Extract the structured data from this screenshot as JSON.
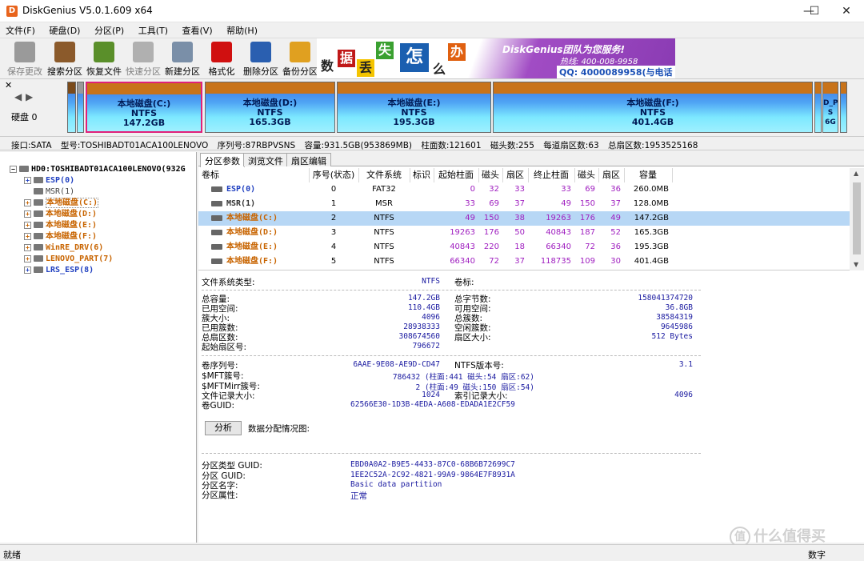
{
  "window": {
    "title": "DiskGenius V5.0.1.609 x64",
    "app_icon": "D",
    "minimize": "—",
    "maximize": "☐",
    "close": "✕"
  },
  "menu": [
    "文件(F)",
    "硬盘(D)",
    "分区(P)",
    "工具(T)",
    "查看(V)",
    "帮助(H)"
  ],
  "toolbar": [
    {
      "label": "保存更改",
      "icon": "save-icon",
      "color": "#9a9a9a",
      "enabled": false
    },
    {
      "label": "搜索分区",
      "icon": "magnifier-icon",
      "color": "#8b5a2b",
      "enabled": true
    },
    {
      "label": "恢复文件",
      "icon": "box-icon",
      "color": "#5a8f2a",
      "enabled": true
    },
    {
      "label": "快速分区",
      "icon": "disk-icon",
      "color": "#b0b0b0",
      "enabled": false
    },
    {
      "label": "新建分区",
      "icon": "drive-icon",
      "color": "#7a8fa8",
      "enabled": true
    },
    {
      "label": "格式化",
      "icon": "format-icon",
      "color": "#d01010",
      "enabled": true
    },
    {
      "label": "删除分区",
      "icon": "trash-icon",
      "color": "#2a5fb0",
      "enabled": true
    },
    {
      "label": "备份分区",
      "icon": "backup-icon",
      "color": "#e0a020",
      "enabled": true
    }
  ],
  "banner": {
    "chars": [
      {
        "c": "数",
        "bg": "#ffffff",
        "fg": "#222222"
      },
      {
        "c": "据",
        "bg": "#c01818",
        "fg": "#ffffff"
      },
      {
        "c": "丢",
        "bg": "#f4c400",
        "fg": "#222222"
      },
      {
        "c": "失",
        "bg": "#3aa030",
        "fg": "#ffffff"
      },
      {
        "c": "怎",
        "bg": "#1a5fb0",
        "fg": "#ffffff"
      },
      {
        "c": "么",
        "bg": "#ffffff",
        "fg": "#222222"
      },
      {
        "c": "办",
        "bg": "#e06010",
        "fg": "#ffffff"
      }
    ],
    "line1": "DiskGenius团队为您服务!",
    "line2": "热线: 400-008-9958",
    "line3": "QQ: 4000089958(与电话同号)"
  },
  "disk_nav": {
    "label": "硬盘 0"
  },
  "disk_segments": [
    {
      "name": "",
      "fs": "",
      "size": ""
    },
    {
      "name": "",
      "fs": "",
      "size": ""
    },
    {
      "name": "本地磁盘(C:)",
      "fs": "NTFS",
      "size": "147.2GB",
      "selected": true
    },
    {
      "name": "本地磁盘(D:)",
      "fs": "NTFS",
      "size": "165.3GB"
    },
    {
      "name": "本地磁盘(E:)",
      "fs": "NTFS",
      "size": "195.3GB"
    },
    {
      "name": "本地磁盘(F:)",
      "fs": "NTFS",
      "size": "401.4GB"
    },
    {
      "name": "D_P",
      "fs": "S",
      "size": "6G"
    },
    {
      "name": "",
      "fs": "",
      "size": ""
    }
  ],
  "disk_info": [
    "接口:SATA",
    "型号:TOSHIBADT01ACA100LENOVO",
    "序列号:87RBPVSNS",
    "容量:931.5GB(953869MB)",
    "柱面数:121601",
    "磁头数:255",
    "每道扇区数:63",
    "总扇区数:1953525168"
  ],
  "tree": {
    "root": "HD0:TOSHIBADT01ACA100LENOVO(932G",
    "items": [
      {
        "label": "ESP(0)",
        "style": "blue"
      },
      {
        "label": "MSR(1)",
        "style": "gray"
      },
      {
        "label": "本地磁盘(C:)",
        "style": "orange"
      },
      {
        "label": "本地磁盘(D:)",
        "style": "orange"
      },
      {
        "label": "本地磁盘(E:)",
        "style": "orange"
      },
      {
        "label": "本地磁盘(F:)",
        "style": "orange"
      },
      {
        "label": "WinRE_DRV(6)",
        "style": "orange"
      },
      {
        "label": "LENOVO_PART(7)",
        "style": "orange"
      },
      {
        "label": "LRS_ESP(8)",
        "style": "blue"
      }
    ]
  },
  "tabs": [
    "分区参数",
    "浏览文件",
    "扇区编辑"
  ],
  "table": {
    "headers": [
      "卷标",
      "序号(状态)",
      "文件系统",
      "标识",
      "起始柱面",
      "磁头",
      "扇区",
      "终止柱面",
      "磁头",
      "扇区",
      "容量"
    ],
    "rows": [
      {
        "name": "ESP(0)",
        "style": "blue",
        "cells": [
          "0",
          "FAT32",
          "",
          "0",
          "32",
          "33",
          "33",
          "69",
          "36",
          "260.0MB"
        ]
      },
      {
        "name": "MSR(1)",
        "style": "gray",
        "cells": [
          "1",
          "MSR",
          "",
          "33",
          "69",
          "37",
          "49",
          "150",
          "37",
          "128.0MB"
        ]
      },
      {
        "name": "本地磁盘(C:)",
        "style": "orange",
        "selected": true,
        "cells": [
          "2",
          "NTFS",
          "",
          "49",
          "150",
          "38",
          "19263",
          "176",
          "49",
          "147.2GB"
        ]
      },
      {
        "name": "本地磁盘(D:)",
        "style": "orange",
        "cells": [
          "3",
          "NTFS",
          "",
          "19263",
          "176",
          "50",
          "40843",
          "187",
          "52",
          "165.3GB"
        ]
      },
      {
        "name": "本地磁盘(E:)",
        "style": "orange",
        "cells": [
          "4",
          "NTFS",
          "",
          "40843",
          "220",
          "18",
          "66340",
          "72",
          "36",
          "195.3GB"
        ]
      },
      {
        "name": "本地磁盘(F:)",
        "style": "orange",
        "cells": [
          "5",
          "NTFS",
          "",
          "66340",
          "72",
          "37",
          "118735",
          "109",
          "30",
          "401.4GB"
        ]
      }
    ]
  },
  "details": {
    "fs_type_label": "文件系统类型:",
    "fs_type": "NTFS",
    "volume_label": "卷标:",
    "total_capacity_label": "总容量:",
    "total_capacity": "147.2GB",
    "used_space_label": "已用空间:",
    "used_space": "110.4GB",
    "cluster_size_label": "簇大小:",
    "cluster_size": "4096",
    "used_clusters_label": "已用簇数:",
    "used_clusters": "28938333",
    "total_sectors_label": "总扇区数:",
    "total_sectors": "308674560",
    "start_sector_label": "起始扇区号:",
    "start_sector": "796672",
    "total_bytes_label": "总字节数:",
    "total_bytes": "158041374720",
    "free_space_label": "可用空间:",
    "free_space": "36.8GB",
    "total_clusters_label": "总簇数:",
    "total_clusters": "38584319",
    "free_clusters_label": "空闲簇数:",
    "free_clusters": "9645986",
    "sector_size_label": "扇区大小:",
    "sector_size": "512 Bytes",
    "serial_label": "卷序列号:",
    "serial": "6AAE-9E08-AE9D-CD47",
    "ntfs_ver_label": "NTFS版本号:",
    "ntfs_ver": "3.1",
    "mft_label": "$MFT簇号:",
    "mft": "786432 (柱面:441 磁头:54 扇区:62)",
    "mftmirr_label": "$MFTMirr簇号:",
    "mftmirr": "2 (柱面:49 磁头:150 扇区:54)",
    "file_record_label": "文件记录大小:",
    "file_record": "1024",
    "index_record_label": "索引记录大小:",
    "index_record": "4096",
    "guid_label": "卷GUID:",
    "guid": "62566E30-1D3B-4EDA-A608-EDADA1E2CF59",
    "analyze_button": "分析",
    "alloc_label": "数据分配情况图:",
    "ptype_guid_label": "分区类型 GUID:",
    "ptype_guid": "EBD0A0A2-B9E5-4433-87C0-68B6B72699C7",
    "pguid_label": "分区 GUID:",
    "pguid": "1EE2C52A-2C92-4821-99A9-9864E7F8931A",
    "pname_label": "分区名字:",
    "pname": "Basic data partition",
    "pattr_label": "分区属性:",
    "pattr": "正常"
  },
  "status": {
    "left": "就绪",
    "right": "数字"
  },
  "watermark": {
    "symbol": "值",
    "text": "什么值得买"
  }
}
